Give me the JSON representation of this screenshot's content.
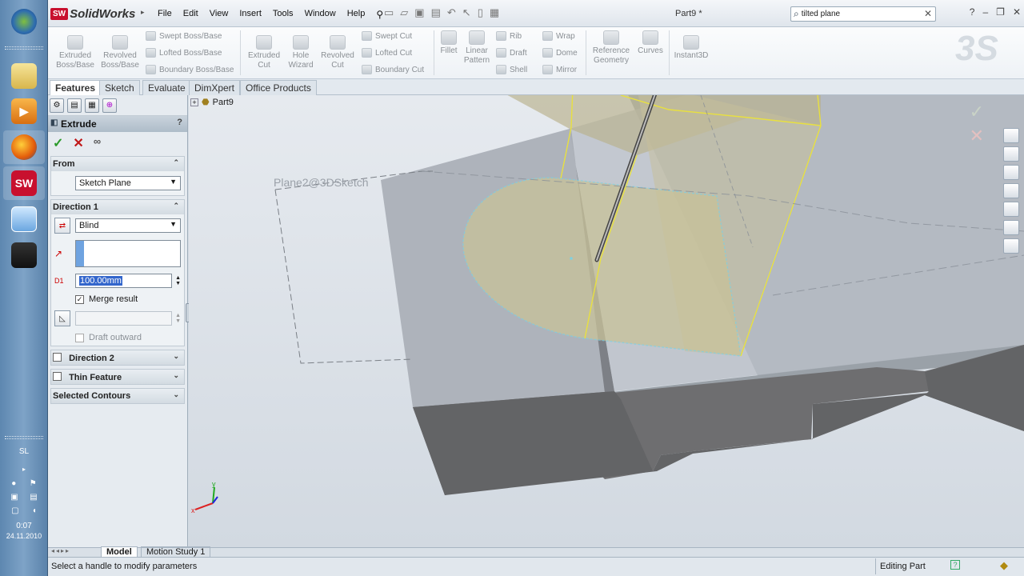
{
  "taskbar": {
    "icons": [
      "windows-start-icon",
      "file-explorer-icon",
      "media-player-icon",
      "firefox-icon",
      "solidworks-icon",
      "notepad-icon",
      "camcorder-icon"
    ],
    "lang": "SL",
    "time": "0:07",
    "date": "24.11.2010"
  },
  "title": {
    "brand": "SolidWorks",
    "brand_badge": "SW",
    "doc": "Part9 *"
  },
  "menus": [
    "File",
    "Edit",
    "View",
    "Insert",
    "Tools",
    "Window",
    "Help"
  ],
  "search": {
    "value": "tilted plane"
  },
  "commands": {
    "extruded_boss": "Extruded Boss/Base",
    "revolved_boss": "Revolved Boss/Base",
    "swept_boss": "Swept Boss/Base",
    "lofted_boss": "Lofted Boss/Base",
    "boundary_boss": "Boundary Boss/Base",
    "extruded_cut": "Extruded Cut",
    "hole_wizard": "Hole Wizard",
    "revolved_cut": "Revolved Cut",
    "swept_cut": "Swept Cut",
    "lofted_cut": "Lofted Cut",
    "boundary_cut": "Boundary Cut",
    "fillet": "Fillet",
    "linear_pattern": "Linear Pattern",
    "rib": "Rib",
    "draft": "Draft",
    "shell": "Shell",
    "wrap": "Wrap",
    "dome": "Dome",
    "mirror": "Mirror",
    "reference_geometry": "Reference Geometry",
    "curves": "Curves",
    "instant3d": "Instant3D"
  },
  "tabs": [
    "Features",
    "Sketch",
    "Evaluate",
    "DimXpert",
    "Office Products"
  ],
  "tree": {
    "root": "Part9"
  },
  "pm": {
    "title": "Extrude",
    "help": "?",
    "from": {
      "label": "From",
      "value": "Sketch Plane"
    },
    "direction1": {
      "label": "Direction 1",
      "end_condition": "Blind",
      "depth": "100.00mm",
      "merge_result": "Merge result",
      "draft_outward": "Draft outward"
    },
    "direction2": {
      "label": "Direction 2"
    },
    "thin_feature": {
      "label": "Thin Feature"
    },
    "selected_contours": {
      "label": "Selected Contours"
    }
  },
  "viewport": {
    "sketch_label": "Plane2@3DSketch"
  },
  "bottom_tabs": [
    "Model",
    "Motion Study 1"
  ],
  "status": {
    "message": "Select a handle to modify parameters",
    "mode": "Editing Part"
  }
}
